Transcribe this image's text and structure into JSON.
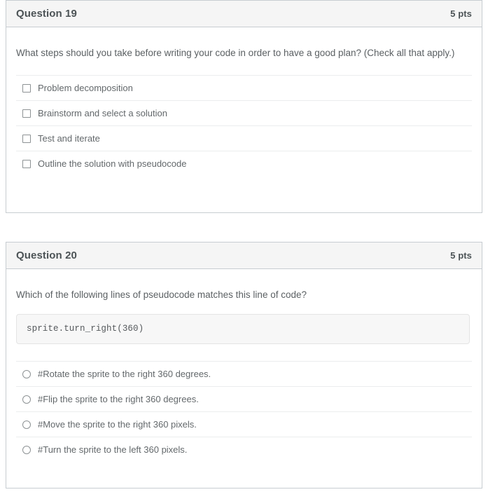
{
  "questions": [
    {
      "name": "Question 19",
      "points": "5 pts",
      "prompt": "What steps should you take before writing your code in order to have a good plan? (Check all that apply.)",
      "input_type": "checkbox",
      "options": [
        "Problem decomposition",
        "Brainstorm and select a solution",
        "Test and iterate",
        "Outline the solution with pseudocode"
      ]
    },
    {
      "name": "Question 20",
      "points": "5 pts",
      "prompt": "Which of the following lines of pseudocode matches this line of code?",
      "code": "sprite.turn_right(360)",
      "input_type": "radio",
      "options": [
        "#Rotate the sprite to the right 360 degrees.",
        "#Flip the sprite to the right 360 degrees.",
        "#Move the sprite to the right 360 pixels.",
        "#Turn the sprite to the left 360 pixels."
      ]
    }
  ],
  "colors": {
    "card_border": "#c7cdd1",
    "header_bg": "#f5f5f5",
    "heading_text": "#4c5356",
    "body_text": "#5b6063",
    "option_text": "#63686b",
    "separator": "#ebedee",
    "code_bg": "#f7f7f7",
    "control_border": "#8d9294"
  }
}
